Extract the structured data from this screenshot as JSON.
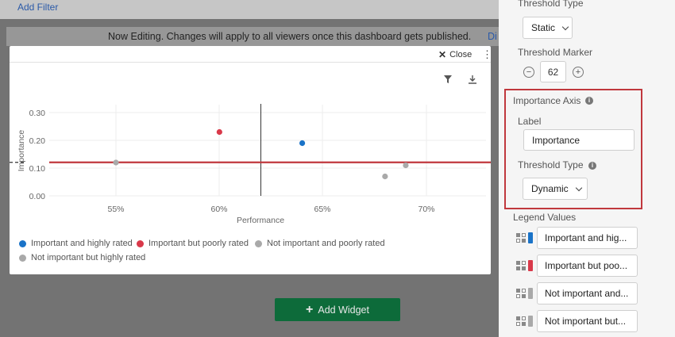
{
  "dashboard": {
    "add_filter": "Add Filter",
    "editing_notice": "Now Editing. Changes will apply to all viewers once this dashboard gets published.",
    "editing_link": "Di",
    "add_widget": "Add Widget"
  },
  "modal": {
    "close_label": "Close",
    "icons": [
      "close-icon",
      "kebab-menu-icon",
      "filter-icon",
      "download-icon"
    ]
  },
  "chart_data": {
    "type": "scatter",
    "xlabel": "Performance",
    "ylabel": "Importance",
    "xlim": [
      0.515,
      0.63
    ],
    "ylim": [
      0,
      0.3
    ],
    "x_ticks": [
      0.55,
      0.6,
      0.65,
      0.7
    ],
    "x_tick_labels": [
      "55%",
      "60%",
      "65%",
      "70%"
    ],
    "y_ticks": [
      0,
      0.1,
      0.2,
      0.3
    ],
    "y_tick_labels": [
      "0.00",
      "0.10",
      "0.20",
      "0.30"
    ],
    "threshold_x": 0.62,
    "threshold_y": 0.115,
    "grid": true,
    "legend_position": "bottom",
    "series": [
      {
        "name": "Important and highly rated",
        "color": "#1a73c8",
        "points": [
          [
            0.64,
            0.19
          ]
        ]
      },
      {
        "name": "Important but poorly rated",
        "color": "#d9394a",
        "points": [
          [
            0.6,
            0.23
          ]
        ]
      },
      {
        "name": "Not important and poorly rated",
        "color": "#a9a9a9",
        "points": [
          [
            0.68,
            0.07
          ],
          [
            0.69,
            0.11
          ]
        ]
      },
      {
        "name": "Not important but highly rated",
        "color": "#a9a9a9",
        "points": [
          [
            0.55,
            0.12
          ]
        ]
      }
    ]
  },
  "panel": {
    "threshold_type_label_top": "Threshold Type",
    "threshold_type_value_top": "Static",
    "threshold_marker_label": "Threshold Marker",
    "threshold_marker_value": "62",
    "importance_axis_title": "Importance Axis",
    "label_caption": "Label",
    "label_value": "Importance",
    "threshold_type_label": "Threshold Type",
    "threshold_type_value": "Dynamic",
    "legend_values_title": "Legend Values",
    "legend_values": [
      {
        "text": "Important and hig...",
        "color": "#1a73c8"
      },
      {
        "text": "Important but poo...",
        "color": "#d9394a"
      },
      {
        "text": "Not important and...",
        "color": "#a9a9a9"
      },
      {
        "text": "Not important but...",
        "color": "#a9a9a9"
      }
    ],
    "highlight_color": "#c0383d"
  }
}
